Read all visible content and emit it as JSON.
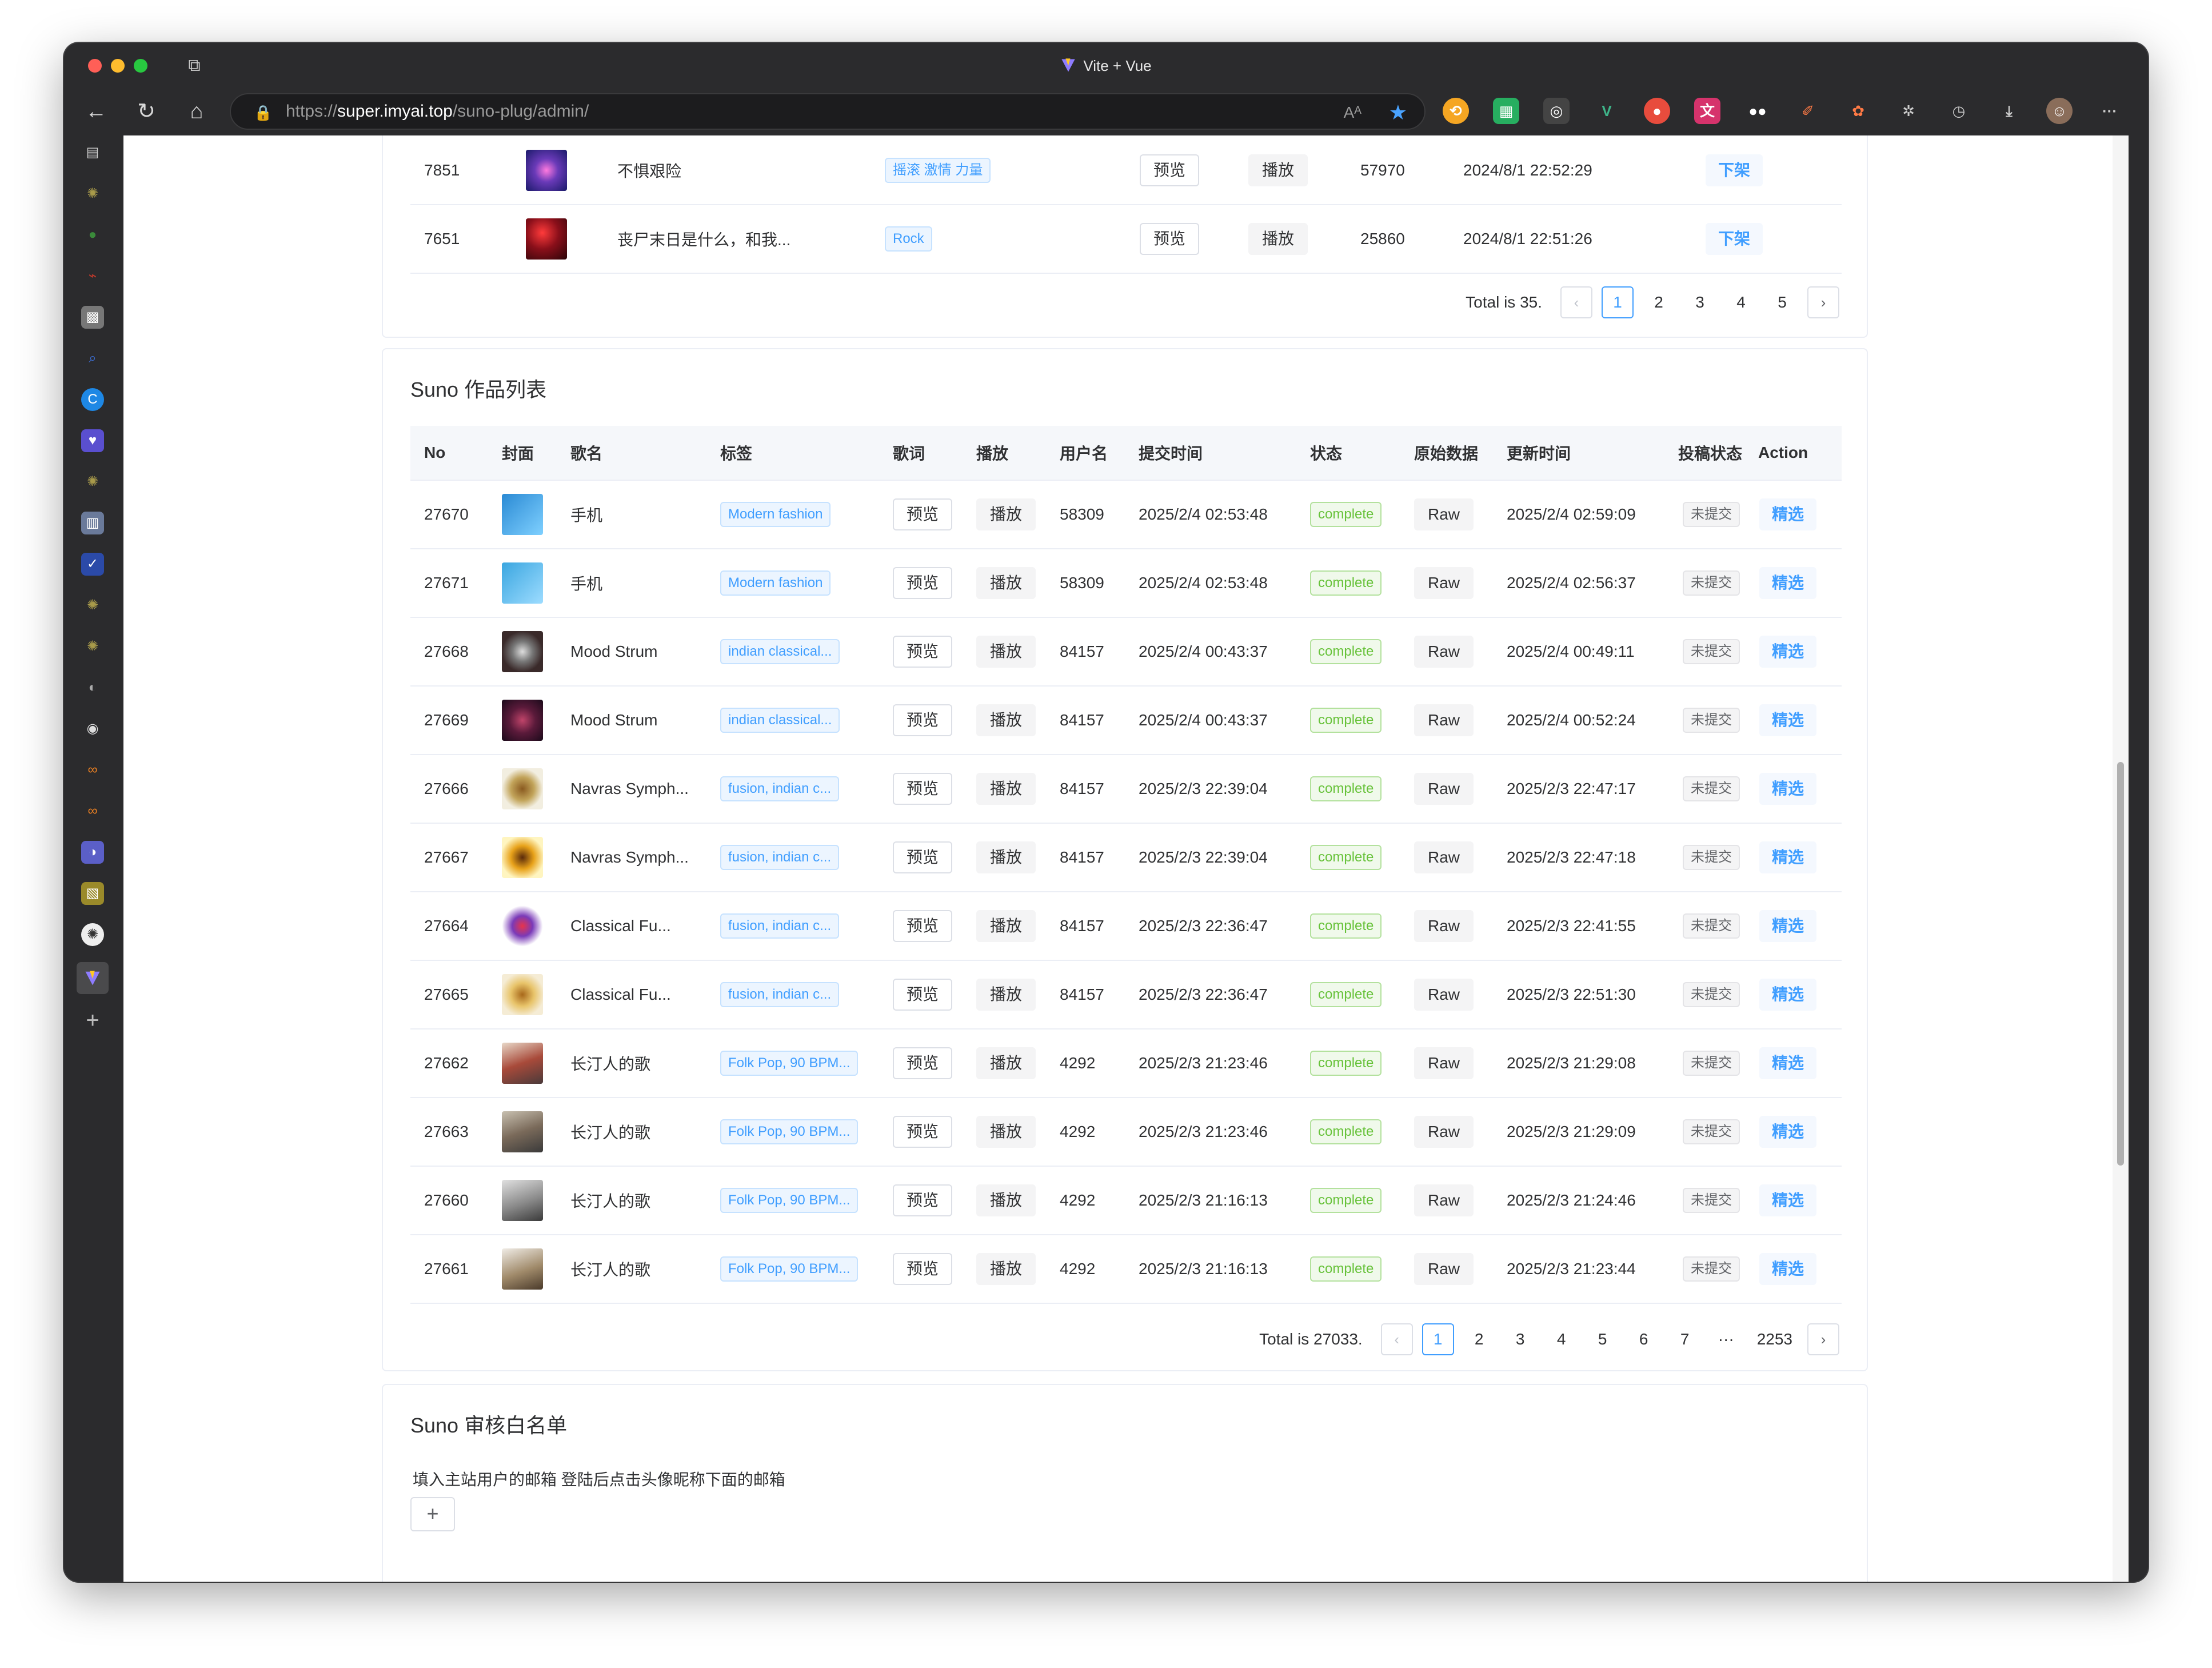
{
  "window": {
    "title": "Vite + Vue",
    "url_scheme": "https://",
    "url_host": "super.imyai.top",
    "url_path": "/suno-plug/admin/"
  },
  "top_table": {
    "rows": [
      {
        "no": "7851",
        "title": "不惧艰险",
        "tag": "摇滚 激情 力量",
        "preview": "预览",
        "play": "播放",
        "user": "57970",
        "time": "2024/8/1 22:52:29",
        "action": "下架"
      },
      {
        "no": "7651",
        "title": "丧尸末日是什么，和我...",
        "tag": "Rock",
        "preview": "预览",
        "play": "播放",
        "user": "25860",
        "time": "2024/8/1 22:51:26",
        "action": "下架"
      }
    ],
    "pager": {
      "total": "Total is 35.",
      "pages": [
        "1",
        "2",
        "3",
        "4",
        "5"
      ],
      "current": "1"
    }
  },
  "works": {
    "title": "Suno 作品列表",
    "headers": {
      "no": "No",
      "cover": "封面",
      "name": "歌名",
      "tags": "标签",
      "lyrics": "歌词",
      "play": "播放",
      "user": "用户名",
      "submit_time": "提交时间",
      "status": "状态",
      "raw": "原始数据",
      "update_time": "更新时间",
      "post_status": "投稿状态",
      "action": "Action"
    },
    "rows": [
      {
        "no": "27670",
        "name": "手机",
        "tag": "Modern fashion",
        "lyrics": "预览",
        "play": "播放",
        "user": "58309",
        "submit": "2025/2/4 02:53:48",
        "status": "complete",
        "raw": "Raw",
        "update": "2025/2/4 02:59:09",
        "post": "未提交",
        "action": "精选"
      },
      {
        "no": "27671",
        "name": "手机",
        "tag": "Modern fashion",
        "lyrics": "预览",
        "play": "播放",
        "user": "58309",
        "submit": "2025/2/4 02:53:48",
        "status": "complete",
        "raw": "Raw",
        "update": "2025/2/4 02:56:37",
        "post": "未提交",
        "action": "精选"
      },
      {
        "no": "27668",
        "name": "Mood Strum",
        "tag": "indian classical...",
        "lyrics": "预览",
        "play": "播放",
        "user": "84157",
        "submit": "2025/2/4 00:43:37",
        "status": "complete",
        "raw": "Raw",
        "update": "2025/2/4 00:49:11",
        "post": "未提交",
        "action": "精选"
      },
      {
        "no": "27669",
        "name": "Mood Strum",
        "tag": "indian classical...",
        "lyrics": "预览",
        "play": "播放",
        "user": "84157",
        "submit": "2025/2/4 00:43:37",
        "status": "complete",
        "raw": "Raw",
        "update": "2025/2/4 00:52:24",
        "post": "未提交",
        "action": "精选"
      },
      {
        "no": "27666",
        "name": "Navras Symph...",
        "tag": "fusion, indian c...",
        "lyrics": "预览",
        "play": "播放",
        "user": "84157",
        "submit": "2025/2/3 22:39:04",
        "status": "complete",
        "raw": "Raw",
        "update": "2025/2/3 22:47:17",
        "post": "未提交",
        "action": "精选"
      },
      {
        "no": "27667",
        "name": "Navras Symph...",
        "tag": "fusion, indian c...",
        "lyrics": "预览",
        "play": "播放",
        "user": "84157",
        "submit": "2025/2/3 22:39:04",
        "status": "complete",
        "raw": "Raw",
        "update": "2025/2/3 22:47:18",
        "post": "未提交",
        "action": "精选"
      },
      {
        "no": "27664",
        "name": "Classical Fu...",
        "tag": "fusion, indian c...",
        "lyrics": "预览",
        "play": "播放",
        "user": "84157",
        "submit": "2025/2/3 22:36:47",
        "status": "complete",
        "raw": "Raw",
        "update": "2025/2/3 22:41:55",
        "post": "未提交",
        "action": "精选"
      },
      {
        "no": "27665",
        "name": "Classical Fu...",
        "tag": "fusion, indian c...",
        "lyrics": "预览",
        "play": "播放",
        "user": "84157",
        "submit": "2025/2/3 22:36:47",
        "status": "complete",
        "raw": "Raw",
        "update": "2025/2/3 22:51:30",
        "post": "未提交",
        "action": "精选"
      },
      {
        "no": "27662",
        "name": "长汀人的歌",
        "tag": "Folk Pop, 90 BPM...",
        "lyrics": "预览",
        "play": "播放",
        "user": "4292",
        "submit": "2025/2/3 21:23:46",
        "status": "complete",
        "raw": "Raw",
        "update": "2025/2/3 21:29:08",
        "post": "未提交",
        "action": "精选"
      },
      {
        "no": "27663",
        "name": "长汀人的歌",
        "tag": "Folk Pop, 90 BPM...",
        "lyrics": "预览",
        "play": "播放",
        "user": "4292",
        "submit": "2025/2/3 21:23:46",
        "status": "complete",
        "raw": "Raw",
        "update": "2025/2/3 21:29:09",
        "post": "未提交",
        "action": "精选"
      },
      {
        "no": "27660",
        "name": "长汀人的歌",
        "tag": "Folk Pop, 90 BPM...",
        "lyrics": "预览",
        "play": "播放",
        "user": "4292",
        "submit": "2025/2/3 21:16:13",
        "status": "complete",
        "raw": "Raw",
        "update": "2025/2/3 21:24:46",
        "post": "未提交",
        "action": "精选"
      },
      {
        "no": "27661",
        "name": "长汀人的歌",
        "tag": "Folk Pop, 90 BPM...",
        "lyrics": "预览",
        "play": "播放",
        "user": "4292",
        "submit": "2025/2/3 21:16:13",
        "status": "complete",
        "raw": "Raw",
        "update": "2025/2/3 21:23:44",
        "post": "未提交",
        "action": "精选"
      }
    ],
    "pager": {
      "total": "Total is 27033.",
      "pages": [
        "1",
        "2",
        "3",
        "4",
        "5",
        "6",
        "7",
        "···",
        "2253"
      ],
      "current": "1"
    }
  },
  "whitelist": {
    "title": "Suno 审核白名单",
    "hint": "填入主站用户的邮箱 登陆后点击头像昵称下面的邮箱",
    "add": "+"
  },
  "colors": {
    "accent": "#409eff",
    "success": "#67c23a",
    "chrome": "#2b2b2d"
  }
}
